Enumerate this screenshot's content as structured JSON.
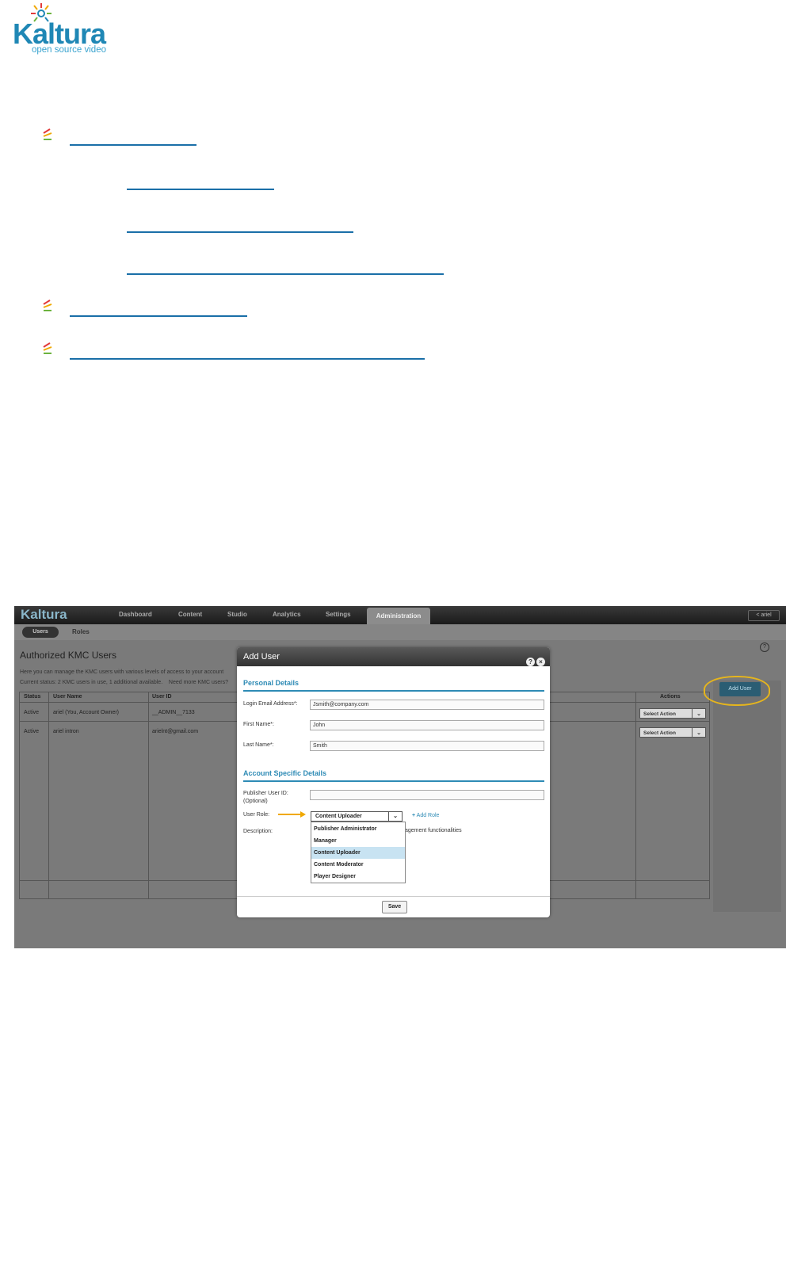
{
  "logo": {
    "word": "Kaltura",
    "tagline": "open source video"
  },
  "screenshot": {
    "app_logo": "Kaltura",
    "tabs": [
      "Dashboard",
      "Content",
      "Studio",
      "Analytics",
      "Settings"
    ],
    "active_tab": "Administration",
    "user_label": "< ariel",
    "subnav": {
      "active": "Users",
      "other": "Roles"
    },
    "heading": "Authorized KMC Users",
    "intro": "Here you can manage the KMC users with various levels of access to your account",
    "status": "Current status: 2 KMC users in use, 1 additional available.    Need more KMC users?",
    "table": {
      "columns": [
        "Status",
        "User Name",
        "User ID",
        "Actions"
      ],
      "rows": [
        {
          "status": "Active",
          "name": "ariel (You, Account Owner)",
          "id": "__ADMIN__7133",
          "action": "Select Action"
        },
        {
          "status": "Active",
          "name": "ariel intron",
          "id": "arielnt@gmail.com",
          "action": "Select Action"
        }
      ]
    },
    "add_user_button": "Add User",
    "modal": {
      "title": "Add User",
      "personal_section": "Personal Details",
      "email_label": "Login Email Address*:",
      "email_value": "Jsmith@company.com",
      "first_label": "First Name*:",
      "first_value": "John",
      "last_label": "Last Name*:",
      "last_value": "Smith",
      "account_section": "Account Specific Details",
      "pubid_label_1": "Publisher User ID:",
      "pubid_label_2": "(Optional)",
      "role_label": "User Role:",
      "role_value": "Content Uploader",
      "add_role": "Add Role",
      "description_label": "Description:",
      "description_tail": "agement functionalities",
      "role_options": [
        "Publisher Administrator",
        "Manager",
        "Content Uploader",
        "Content Moderator",
        "Player Designer"
      ],
      "selected_option": "Content Uploader",
      "save": "Save"
    }
  }
}
